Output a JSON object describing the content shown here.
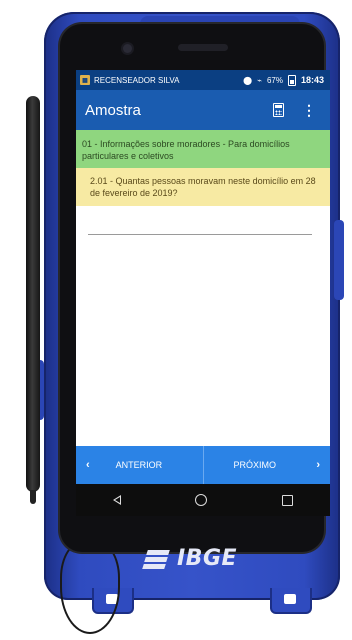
{
  "status_bar": {
    "app_name": "RECENSEADOR SILVA",
    "battery": "67%",
    "time": "18:43"
  },
  "app_bar": {
    "title": "Amostra",
    "calculator_icon": "calculator-icon",
    "overflow_icon": "more-vert-icon"
  },
  "section": {
    "text": "01 - Informações sobre moradores - Para domicílios particulares e coletivos"
  },
  "question": {
    "text": "2.01 - Quantas pessoas moravam neste domicílio em 28 de fevereiro de 2019?"
  },
  "answer": {
    "value": ""
  },
  "nav": {
    "prev_label": "ANTERIOR",
    "next_label": "PRÓXIMO",
    "prev_glyph": "‹",
    "next_glyph": "›"
  },
  "device": {
    "brand_label": "IBGE"
  },
  "colors": {
    "status_bar": "#0b3f82",
    "app_bar": "#1a5cb0",
    "section_bg": "#8fd67f",
    "question_bg": "#f7eaa3",
    "nav_bg": "#2b83e6",
    "case": "#3653c9"
  }
}
